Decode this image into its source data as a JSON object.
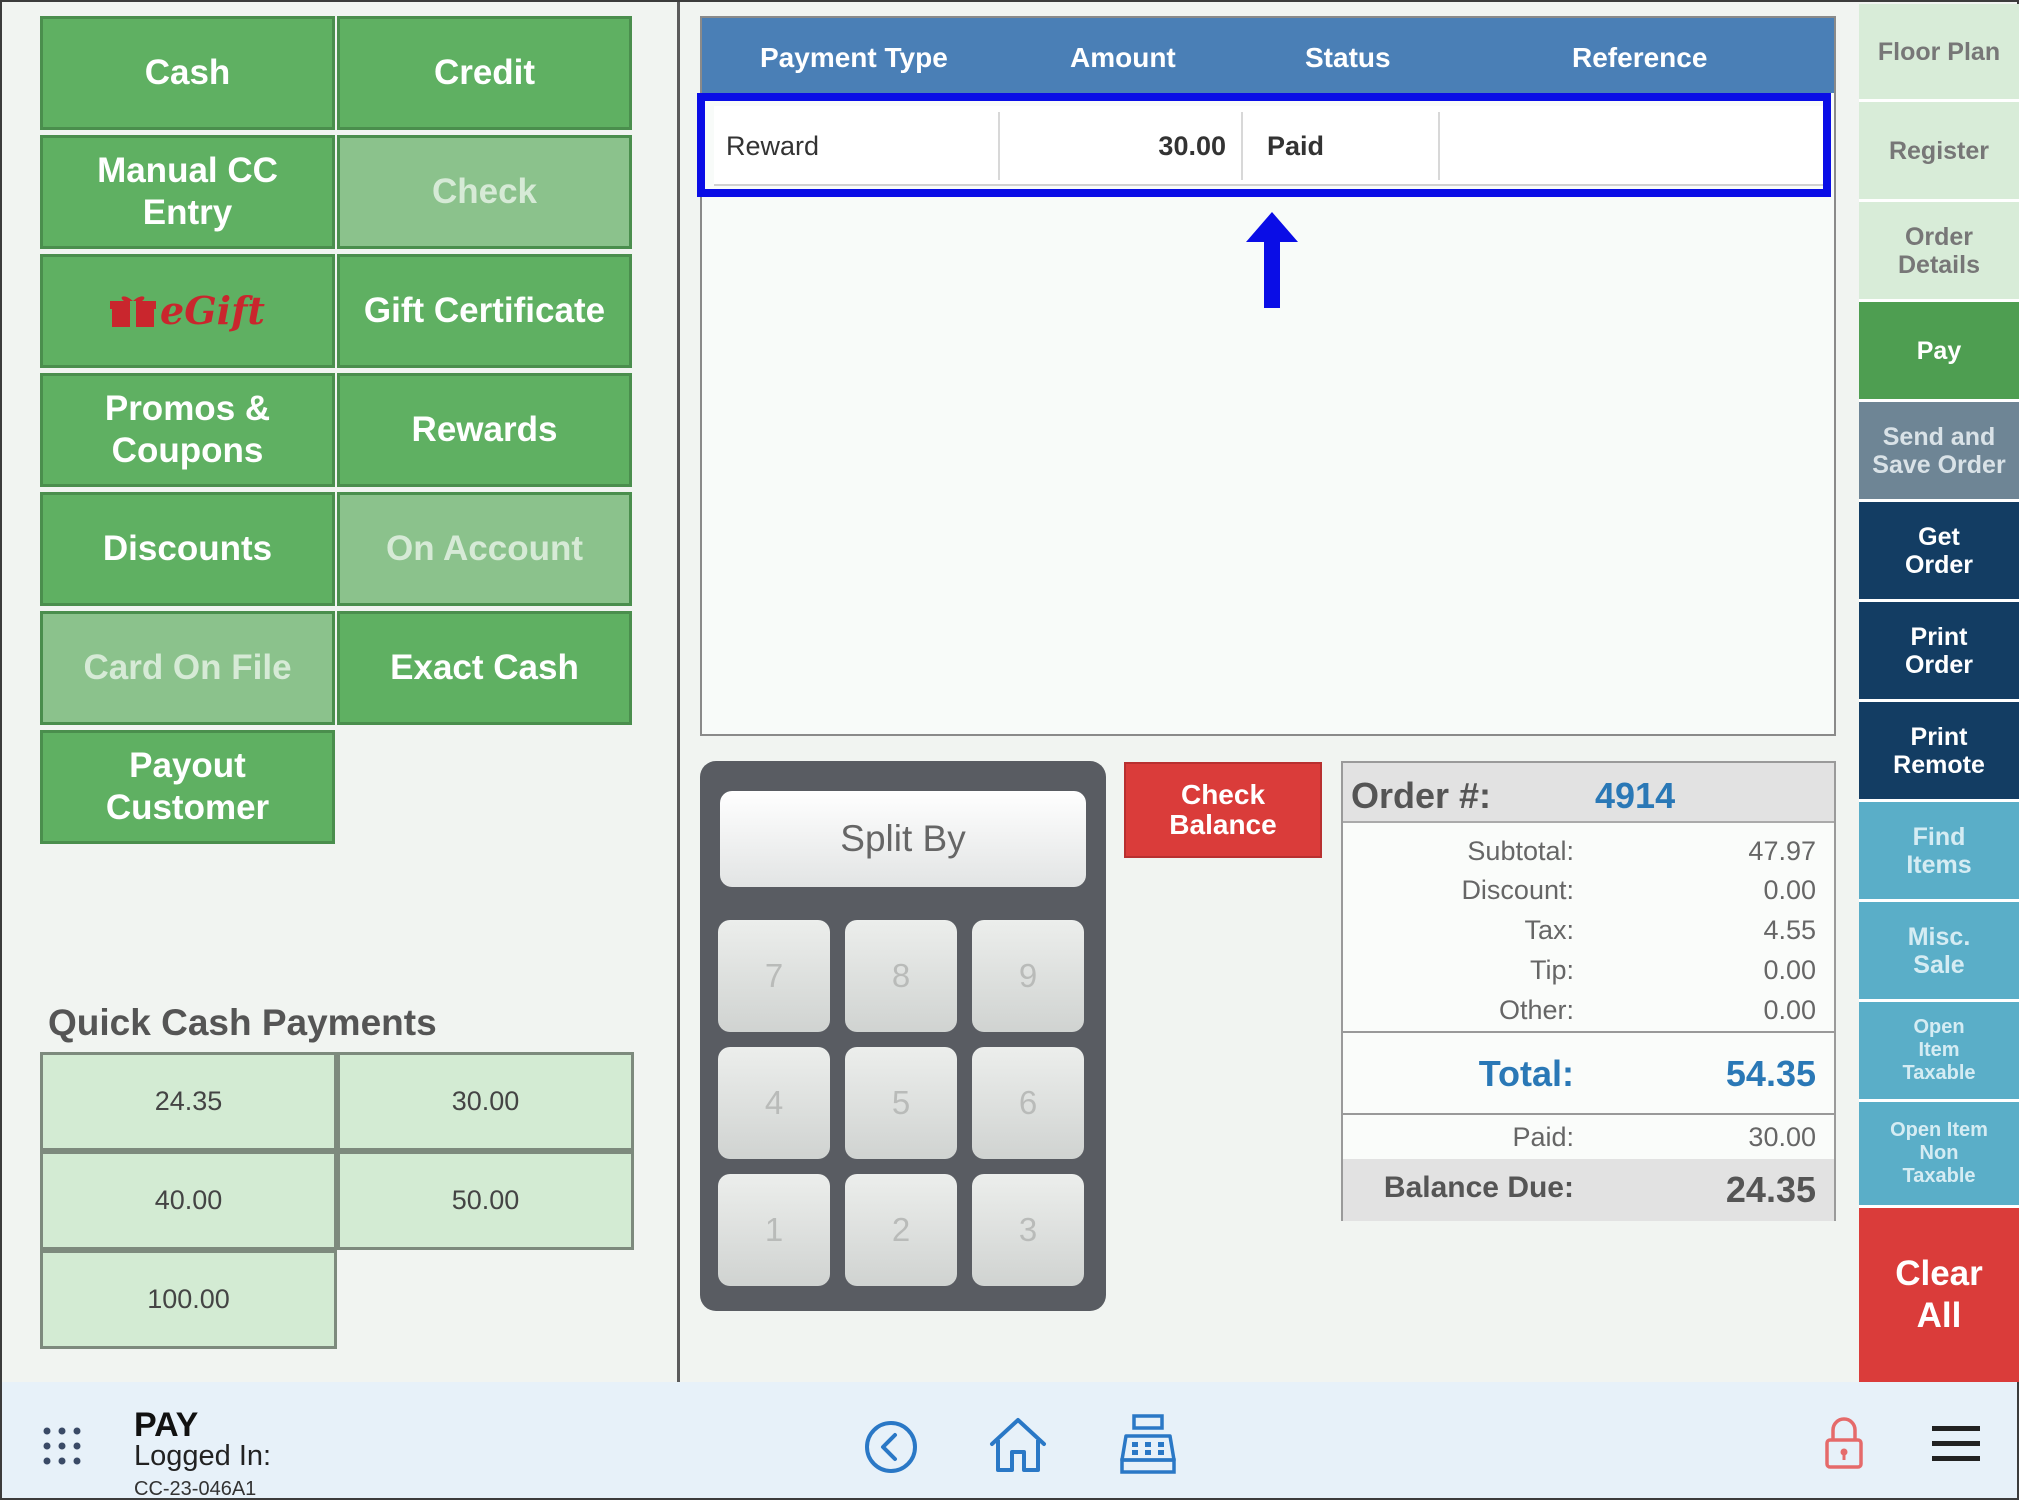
{
  "payment_buttons": {
    "cash": "Cash",
    "credit": "Credit",
    "manual_cc": "Manual CC Entry",
    "check": "Check",
    "egift": "eGift",
    "gift_certificate": "Gift Certificate",
    "promos": "Promos & Coupons",
    "rewards": "Rewards",
    "discounts": "Discounts",
    "on_account": "On Account",
    "card_on_file": "Card On File",
    "exact_cash": "Exact Cash",
    "payout_customer": "Payout Customer"
  },
  "quick_cash": {
    "title": "Quick Cash Payments",
    "amounts": [
      "24.35",
      "30.00",
      "40.00",
      "50.00",
      "100.00"
    ]
  },
  "payment_table": {
    "headers": [
      "Payment Type",
      "Amount",
      "Status",
      "Reference"
    ],
    "rows": [
      {
        "type": "Reward",
        "amount": "30.00",
        "status": "Paid",
        "reference": ""
      }
    ]
  },
  "keypad": {
    "split_label": "Split By",
    "keys": [
      "7",
      "8",
      "9",
      "4",
      "5",
      "6",
      "1",
      "2",
      "3"
    ]
  },
  "check_balance_label": "Check Balance",
  "order": {
    "label": "Order #:",
    "number": "4914",
    "subtotal_label": "Subtotal:",
    "subtotal": "47.97",
    "discount_label": "Discount:",
    "discount": "0.00",
    "tax_label": "Tax:",
    "tax": "4.55",
    "tip_label": "Tip:",
    "tip": "0.00",
    "other_label": "Other:",
    "other": "0.00",
    "total_label": "Total:",
    "total": "54.35",
    "paid_label": "Paid:",
    "paid": "30.00",
    "balance_label": "Balance Due:",
    "balance": "24.35"
  },
  "nav": {
    "floor_plan": "Floor Plan",
    "register": "Register",
    "order_details": "Order Details",
    "pay": "Pay",
    "send_save": "Send and Save Order",
    "get_order": "Get Order",
    "print_order": "Print Order",
    "print_remote": "Print Remote",
    "find_items": "Find Items",
    "misc_sale": "Misc. Sale",
    "open_taxable": "Open Item Taxable",
    "open_non_taxable": "Open Item Non Taxable",
    "clear_all": "Clear All"
  },
  "footer": {
    "screen": "PAY",
    "logged_in": "Logged In:",
    "device": "CC-23-046A1"
  },
  "colors": {
    "button_green": "#5fb062",
    "header_blue": "#4a7fb6",
    "highlight_blue": "#0a0de6",
    "alert_red": "#da3c3a",
    "navy": "#133d63"
  }
}
